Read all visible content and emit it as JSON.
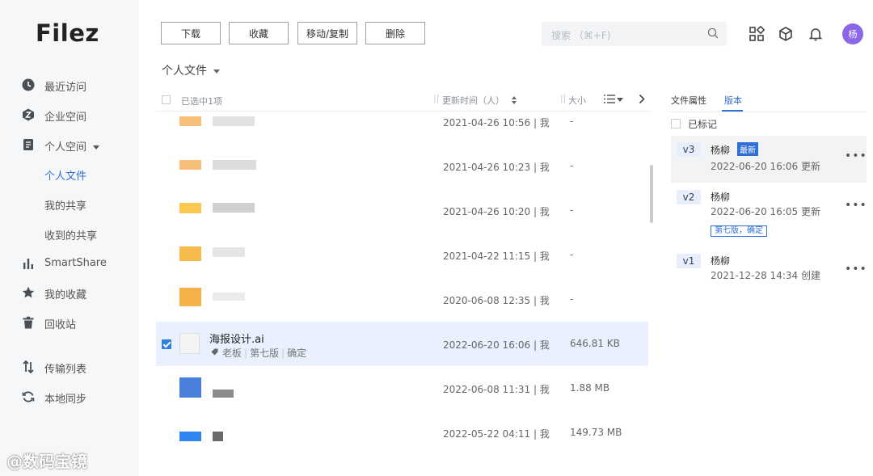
{
  "app": {
    "logo": "Filez"
  },
  "sidebar": {
    "items": [
      {
        "label": "最近访问",
        "icon": "clock-icon"
      },
      {
        "label": "企业空间",
        "icon": "enterprise-icon"
      },
      {
        "label": "个人空间",
        "icon": "personal-space-icon"
      },
      {
        "label": "个人文件",
        "active": true
      },
      {
        "label": "我的共享"
      },
      {
        "label": "收到的共享"
      },
      {
        "label": "SmartShare",
        "icon": "bar-chart-icon"
      },
      {
        "label": "我的收藏",
        "icon": "star-icon"
      },
      {
        "label": "回收站",
        "icon": "trash-icon"
      },
      {
        "label": "传输列表",
        "icon": "transfer-icon"
      },
      {
        "label": "本地同步",
        "icon": "sync-icon"
      }
    ]
  },
  "toolbar": {
    "download": "下载",
    "favorite": "收藏",
    "move_copy": "移动/复制",
    "delete": "删除",
    "search_placeholder": "搜索 （⌘+F)"
  },
  "header": {
    "avatar": "杨",
    "folder": "个人文件"
  },
  "list": {
    "selected_text": "已选中1项",
    "col_updated": "更新时间（人）",
    "col_size": "大小",
    "rows": [
      {
        "time": "2021-04-26 10:56 | 我",
        "size": "-"
      },
      {
        "time": "2021-04-26 10:23 | 我",
        "size": "-"
      },
      {
        "time": "2021-04-26 10:20 | 我",
        "size": "-"
      },
      {
        "time": "2021-04-22 11:15 | 我",
        "size": "-"
      },
      {
        "time": "2020-06-08 12:35 | 我",
        "size": "-"
      },
      {
        "name": "海报设计.ai",
        "tags": [
          "老板",
          "第七版",
          "确定"
        ],
        "time": "2022-06-20 16:06 | 我",
        "size": "646.81 KB",
        "selected": true
      },
      {
        "time": "2022-06-08 11:31 | 我",
        "size": "1.88 MB"
      },
      {
        "time": "2022-05-22 04:11 | 我",
        "size": "149.73 MB"
      }
    ]
  },
  "panel": {
    "tab_properties": "文件属性",
    "tab_versions": "版本",
    "marked_label": "已标记",
    "versions": [
      {
        "ver": "v3",
        "user": "杨柳",
        "badge": "最新",
        "time": "2022-06-20 16:06 更新"
      },
      {
        "ver": "v2",
        "user": "杨柳",
        "time": "2022-06-20 16:05 更新",
        "note": "第七版，确定"
      },
      {
        "ver": "v1",
        "user": "杨柳",
        "time": "2021-12-28 14:34 创建"
      }
    ]
  },
  "watermark": "@数码宝镜"
}
